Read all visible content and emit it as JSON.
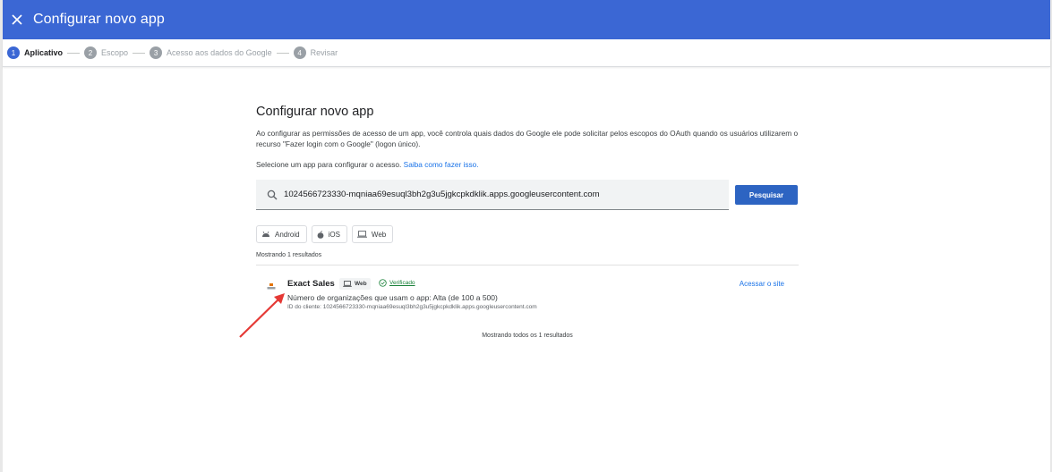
{
  "header": {
    "title": "Configurar novo app",
    "close_icon": "close-icon",
    "bg_color": "#3b67d4"
  },
  "stepper": {
    "steps": [
      {
        "num": "1",
        "label": "Aplicativo",
        "active": true
      },
      {
        "num": "2",
        "label": "Escopo",
        "active": false
      },
      {
        "num": "3",
        "label": "Acesso aos dados do Google",
        "active": false
      },
      {
        "num": "4",
        "label": "Revisar",
        "active": false
      }
    ]
  },
  "main": {
    "title": "Configurar novo app",
    "description": "Ao configurar as permissões de acesso de um app, você controla quais dados do Google ele pode solicitar pelos escopos do OAuth quando os usuários utilizarem o recurso \"Fazer login com o Google\" (logon único).",
    "select_prompt": "Selecione um app para configurar o acesso.",
    "learn_link": "Saiba como fazer isso.",
    "search": {
      "value": "1024566723330-mqniaa69esuql3bh2g3u5jgkcpkdklik.apps.googleusercontent.com",
      "button": "Pesquisar"
    },
    "filters": [
      {
        "label": "Android",
        "icon": "android-icon"
      },
      {
        "label": "iOS",
        "icon": "apple-icon"
      },
      {
        "label": "Web",
        "icon": "laptop-icon"
      }
    ],
    "results_count": "Mostrando 1 resultados",
    "results": [
      {
        "name": "Exact Sales",
        "type": "Web",
        "verified": "Verificado",
        "orgs": "Número de organizações que usam o app: Alta (de 100 a 500)",
        "client_id": "ID do cliente: 1024566723330-mqniaa69esuql3bh2g3u5jgkcpkdklik.apps.googleusercontent.com",
        "visit": "Acessar o site"
      }
    ],
    "footer": "Mostrando todos os 1 resultados"
  },
  "annotation": {
    "arrow_color": "#e53935"
  }
}
